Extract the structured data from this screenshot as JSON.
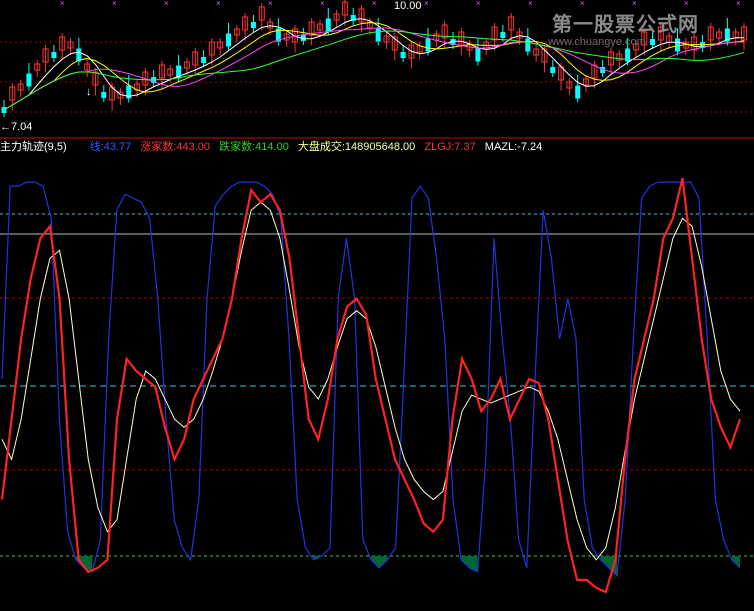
{
  "header": {
    "indicator_name": "主力轨迹(9,5)",
    "line_label": "线:43.77",
    "up_count": "涨家数:443.00",
    "down_count": "跌家数:414.00",
    "volume": "大盘成交:148905648.00",
    "zlgj": "ZLGJ:7.37",
    "mazl": "MAZL:-7.24"
  },
  "price_panel": {
    "high_label": "10.00",
    "low_label": "←7.04",
    "low_marker": "↓"
  },
  "watermark": {
    "text": "第一股票公式网",
    "url": "www.chuangye.com"
  },
  "colors": {
    "background": "#000000",
    "up_candle": "#ff3333",
    "down_candle": "#00ffff",
    "blue_line": "#2233dd",
    "red_line": "#ff2222",
    "white_line": "#ffffcc",
    "green_fill": "#006633",
    "dashed_red": "#aa0000",
    "dashed_cyan": "#33cccc"
  },
  "chart_data": [
    {
      "type": "line",
      "title": "",
      "series": [
        {
          "name": "线",
          "values": [
            50,
            98,
            98,
            99,
            99,
            98,
            90,
            40,
            12,
            5,
            3,
            2,
            10,
            60,
            92,
            96,
            95,
            94,
            90,
            70,
            40,
            15,
            8,
            5,
            20,
            70,
            93,
            96,
            98,
            99,
            99,
            99,
            98,
            96,
            90,
            60,
            20,
            8,
            5,
            6,
            8,
            70,
            85,
            70,
            10,
            5,
            3,
            5,
            8,
            50,
            95,
            98,
            95,
            80,
            60,
            20,
            5,
            3,
            2,
            30,
            85,
            60,
            40,
            10,
            3,
            50,
            92,
            80,
            60,
            70,
            60,
            20,
            8,
            5,
            3,
            1,
            20,
            60,
            95,
            98,
            99,
            99,
            99,
            99,
            99,
            95,
            60,
            20,
            10,
            5,
            3
          ]
        },
        {
          "name": "ZLGJ",
          "values": [
            20,
            40,
            60,
            75,
            85,
            88,
            70,
            30,
            5,
            2,
            3,
            5,
            40,
            55,
            52,
            50,
            48,
            38,
            30,
            35,
            45,
            50,
            55,
            60,
            70,
            85,
            97,
            94,
            96,
            92,
            80,
            60,
            40,
            35,
            45,
            60,
            68,
            70,
            66,
            50,
            40,
            30,
            25,
            20,
            14,
            12,
            15,
            40,
            55,
            50,
            42,
            45,
            50,
            40,
            45,
            50,
            49,
            40,
            25,
            10,
            0,
            0,
            -2,
            -3,
            5,
            30,
            50,
            60,
            70,
            85,
            90,
            100,
            80,
            60,
            45,
            38,
            33,
            40
          ]
        }
      ]
    },
    {
      "type": "line",
      "series": [
        {
          "name": "MAZL",
          "values": [
            35,
            30,
            40,
            55,
            70,
            80,
            82,
            70,
            50,
            30,
            18,
            12,
            15,
            30,
            45,
            52,
            50,
            45,
            40,
            38,
            40,
            45,
            52,
            60,
            70,
            82,
            92,
            94,
            92,
            85,
            72,
            58,
            48,
            45,
            50,
            58,
            65,
            67,
            65,
            58,
            48,
            38,
            30,
            25,
            22,
            20,
            22,
            32,
            42,
            46,
            45,
            44,
            45,
            46,
            47,
            48,
            47,
            42,
            35,
            25,
            15,
            8,
            5,
            8,
            18,
            32,
            45,
            55,
            65,
            75,
            85,
            90,
            88,
            78,
            65,
            52,
            45,
            42
          ]
        }
      ]
    }
  ]
}
